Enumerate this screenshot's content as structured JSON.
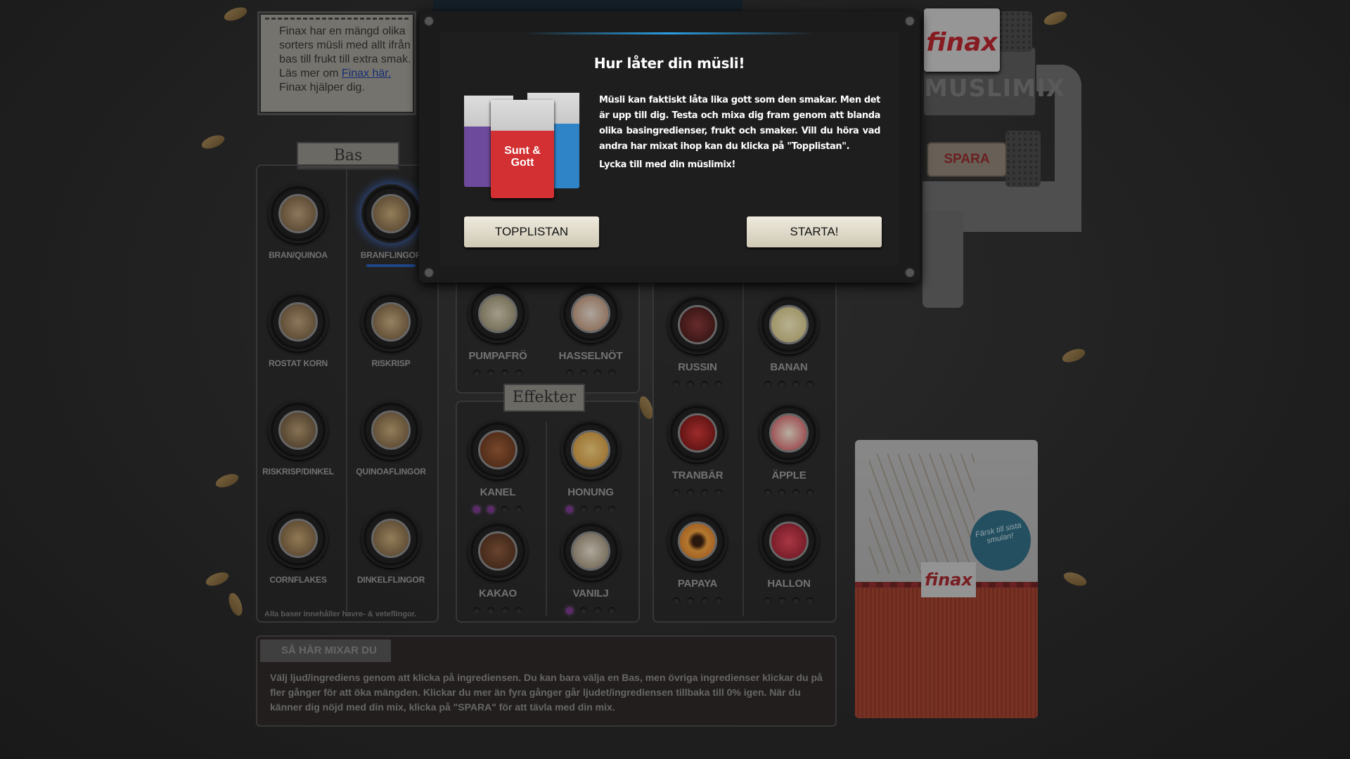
{
  "info": {
    "line1": "Finax har en mängd olika",
    "line2": "sorters müsli med allt ifrån",
    "line3": "bas till frukt till extra smak.",
    "line4_prefix": "Läs mer om ",
    "line4_link": "Finax här.",
    "line5": "Finax hjälper dig."
  },
  "labels": {
    "bas": "Bas",
    "effekter": "Effekter"
  },
  "bas_items": [
    "BRAN/QUINOA",
    "BRANFLINGOR",
    "ROSTAT KORN",
    "RISKRISP",
    "RISKRISP/DINKEL",
    "QUINOAFLINGOR",
    "CORNFLAKES",
    "DINKELFLINGOR"
  ],
  "bas_footer": "Alla baser innehåller havre- & veteflingor.",
  "seeds": [
    "PUMPAFRÖ",
    "HASSELNÖT"
  ],
  "effekter": [
    "KANEL",
    "HONUNG",
    "KAKAO",
    "VANILJ"
  ],
  "frukt": [
    "RUSSIN",
    "BANAN",
    "TRANBÄR",
    "ÄPPLE",
    "PAPAYA",
    "HALLON"
  ],
  "howto": {
    "title": "SÅ HÄR MIXAR DU",
    "text": "Välj ljud/ingrediens genom att klicka på ingrediensen. Du kan bara välja en Bas, men övriga ingredienser klickar du på fler gånger för att öka mängden. Klickar du mer än fyra gånger går ljudet/ingrediensen tillbaka till 0% igen. När du känner dig nöjd med din mix, klicka på \"SPARA\" för att tävla med din mix."
  },
  "machine": {
    "logo": "finax",
    "title": "MUSLIMIX",
    "save": "SPARA"
  },
  "bag": {
    "logo": "finax",
    "badge": "Färsk till sista smulan!"
  },
  "modal": {
    "title": "Hur låter din müsli!",
    "p1": "Müsli kan faktiskt låta lika gott som den smakar. Men det är upp till dig. Testa och mixa dig fram genom att blanda olika basingredienser, frukt och smaker. Vill du höra vad andra har mixat ihop kan du klicka på \"Topplistan\".",
    "p2": "Lycka till med din müslimix!",
    "product_label": "Sunt & Gott",
    "btn_top": "TOPPLISTAN",
    "btn_start": "STARTA!"
  }
}
